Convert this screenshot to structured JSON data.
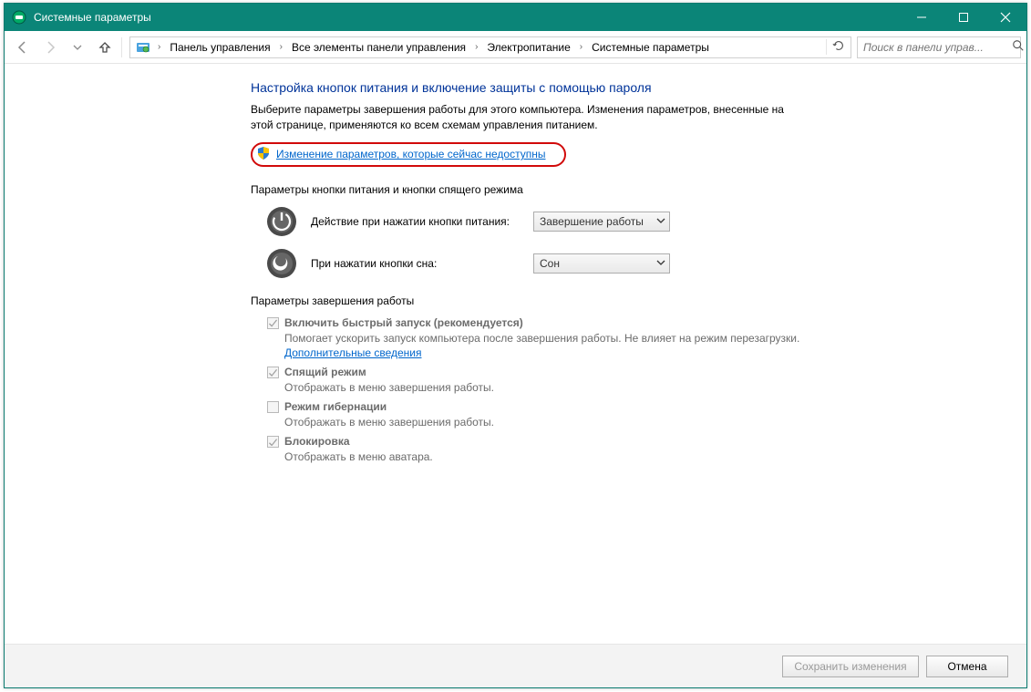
{
  "titlebar": {
    "title": "Системные параметры"
  },
  "breadcrumb": {
    "items": [
      "Панель управления",
      "Все элементы панели управления",
      "Электропитание",
      "Системные параметры"
    ]
  },
  "search": {
    "placeholder": "Поиск в панели управ..."
  },
  "page": {
    "title": "Настройка кнопок питания и включение защиты с помощью пароля",
    "intro": "Выберите параметры завершения работы для этого компьютера. Изменения параметров, внесенные на этой странице, применяются ко всем схемам управления питанием.",
    "uac_link": "Изменение параметров, которые сейчас недоступны",
    "section_buttons": "Параметры кнопки питания и кнопки спящего режима",
    "opt_power_label": "Действие при нажатии кнопки питания:",
    "opt_power_value": "Завершение работы",
    "opt_sleep_label": "При нажатии кнопки сна:",
    "opt_sleep_value": "Сон",
    "section_shutdown": "Параметры завершения работы",
    "fast": {
      "label": "Включить быстрый запуск (рекомендуется)",
      "desc1": "Помогает ускорить запуск компьютера после завершения работы. Не влияет на режим перезагрузки. ",
      "link": "Дополнительные сведения"
    },
    "sleep": {
      "label": "Спящий режим",
      "desc": "Отображать в меню завершения работы."
    },
    "hiber": {
      "label": "Режим гибернации",
      "desc": "Отображать в меню завершения работы."
    },
    "lock": {
      "label": "Блокировка",
      "desc": "Отображать в меню аватара."
    }
  },
  "footer": {
    "save": "Сохранить изменения",
    "cancel": "Отмена"
  }
}
